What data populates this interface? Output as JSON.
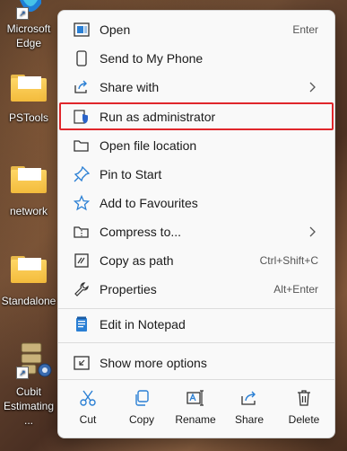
{
  "desktop": {
    "icons": [
      {
        "label": "Microsoft Edge"
      },
      {
        "label": "PSTools"
      },
      {
        "label": "network"
      },
      {
        "label": "Standalone"
      },
      {
        "label": "Cubit Estimating ..."
      }
    ]
  },
  "menu": {
    "items": [
      {
        "label": "Open",
        "shortcut": "Enter"
      },
      {
        "label": "Send to My Phone"
      },
      {
        "label": "Share with"
      },
      {
        "label": "Run as administrator"
      },
      {
        "label": "Open file location"
      },
      {
        "label": "Pin to Start"
      },
      {
        "label": "Add to Favourites"
      },
      {
        "label": "Compress to..."
      },
      {
        "label": "Copy as path",
        "shortcut": "Ctrl+Shift+C"
      },
      {
        "label": "Properties",
        "shortcut": "Alt+Enter"
      },
      {
        "label": "Edit in Notepad"
      },
      {
        "label": "Show more options"
      }
    ],
    "actions": [
      {
        "label": "Cut"
      },
      {
        "label": "Copy"
      },
      {
        "label": "Rename"
      },
      {
        "label": "Share"
      },
      {
        "label": "Delete"
      }
    ]
  },
  "colors": {
    "accent": "#0067c0",
    "highlight_border": "#e0262b",
    "menu_bg": "#f9f9f9"
  }
}
